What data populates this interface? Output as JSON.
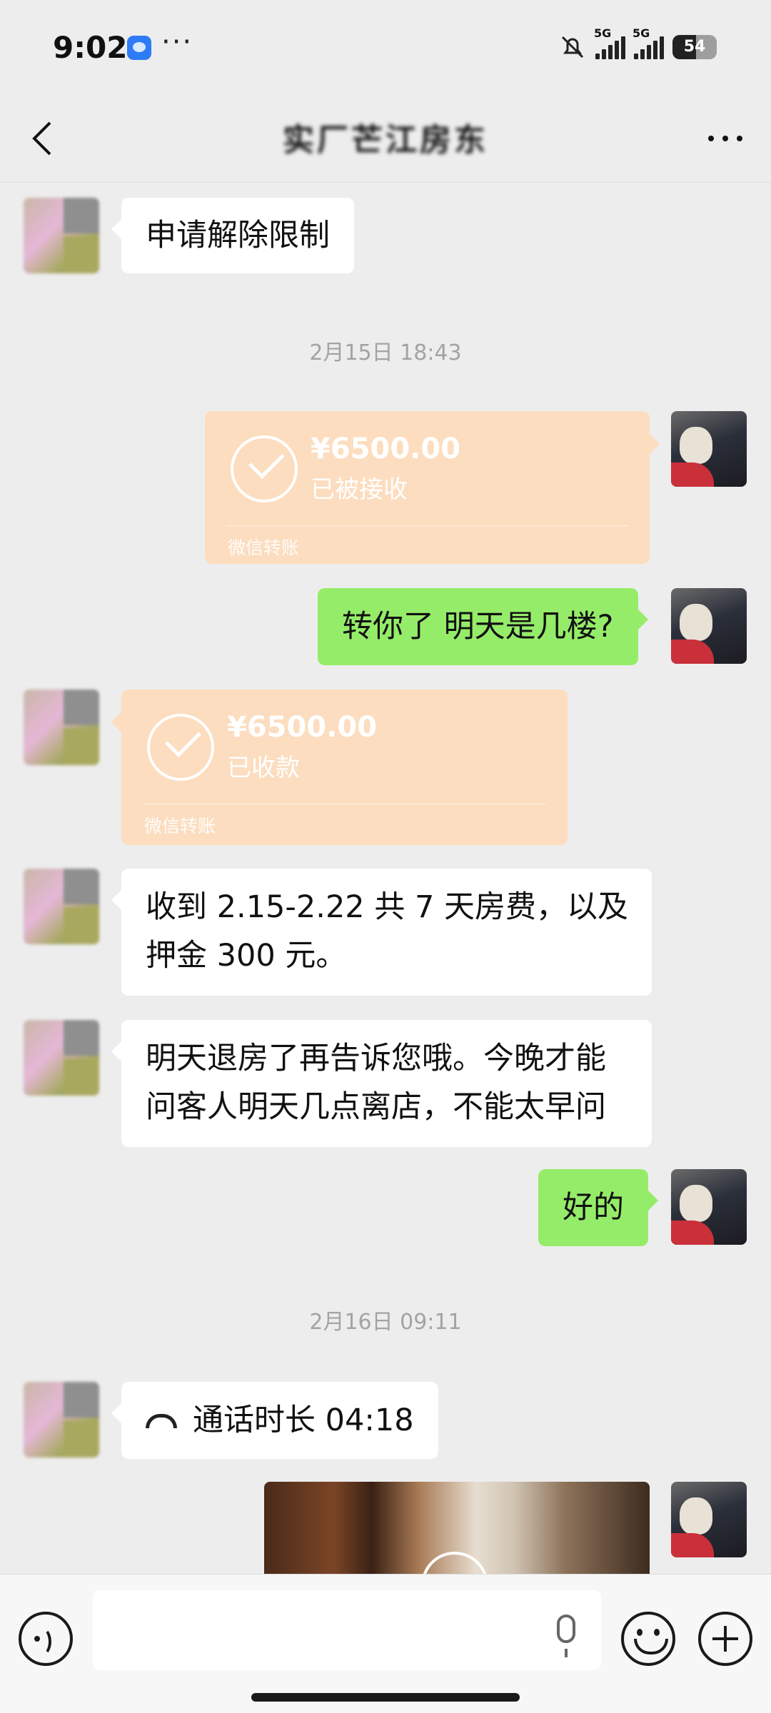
{
  "status_bar": {
    "time": "9:02",
    "signal_1": "5G",
    "signal_2": "5G",
    "battery": "54"
  },
  "header": {
    "title": "实厂芒江房东"
  },
  "messages": {
    "m1": "申请解除限制",
    "t1": "2月15日 18:43",
    "tr1_amount": "¥6500.00",
    "tr1_status": "已被接收",
    "tr1_label": "微信转账",
    "m2": "转你了 明天是几楼?",
    "tr2_amount": "¥6500.00",
    "tr2_status": "已收款",
    "tr2_label": "微信转账",
    "m3_line1": "收到 2.15-2.22 共 7 天房费，以及",
    "m3_line2": "押金 300 元。",
    "m4_line1": "明天退房了再告诉您哦。今晚才能",
    "m4_line2": "问客人明天几点离店，不能太早问",
    "m5": "好的",
    "t2": "2月16日 09:11",
    "call": "通话时长 04:18"
  },
  "input_bar": {
    "placeholder": ""
  }
}
